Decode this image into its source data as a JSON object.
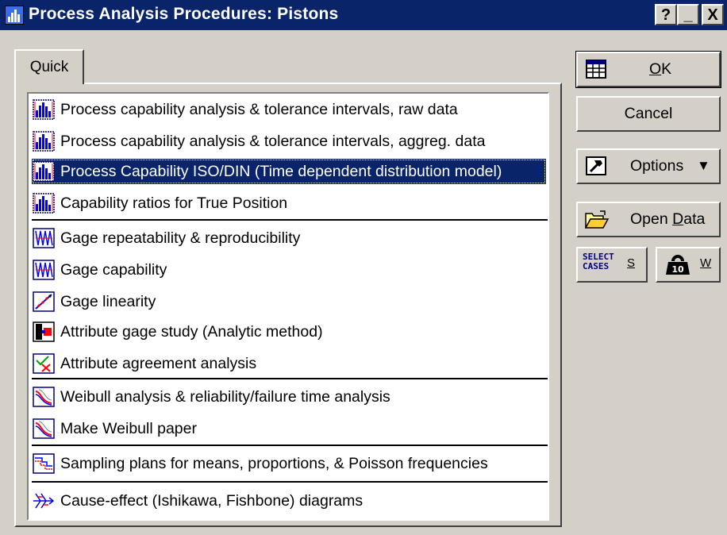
{
  "window": {
    "title": "Process Analysis Procedures: Pistons",
    "controls": {
      "help": "?",
      "minimize": "_",
      "close": "X"
    }
  },
  "tabs": [
    {
      "label": "Quick",
      "selected": true
    }
  ],
  "list": {
    "selected_index": 2,
    "items": [
      {
        "label": "Process capability analysis & tolerance intervals, raw data",
        "icon": "capability-histogram-icon"
      },
      {
        "label": "Process capability analysis & tolerance intervals, aggreg. data",
        "icon": "capability-histogram-icon"
      },
      {
        "label": "Process Capability  ISO/DIN (Time dependent distribution model)",
        "icon": "capability-histogram-icon"
      },
      {
        "label": "Capability ratios for True Position",
        "icon": "capability-histogram-icon"
      },
      {
        "label": "Gage repeatability & reproducibility",
        "icon": "gage-rr-icon"
      },
      {
        "label": "Gage capability",
        "icon": "gage-rr-icon"
      },
      {
        "label": "Gage linearity",
        "icon": "gage-linearity-icon"
      },
      {
        "label": "Attribute gage study (Analytic method)",
        "icon": "attribute-gage-icon"
      },
      {
        "label": "Attribute agreement analysis",
        "icon": "attribute-agreement-icon"
      },
      {
        "label": "Weibull analysis & reliability/failure time analysis",
        "icon": "weibull-icon"
      },
      {
        "label": "Make Weibull paper",
        "icon": "weibull-icon"
      },
      {
        "label": "Sampling plans for means, proportions, & Poisson frequencies",
        "icon": "sampling-plan-icon"
      },
      {
        "label": "Cause-effect (Ishikawa, Fishbone) diagrams",
        "icon": "fishbone-icon"
      }
    ]
  },
  "buttons": {
    "ok": {
      "label_prefix": "",
      "label_mnemonic": "O",
      "label_suffix": "K",
      "icon": "spreadsheet-icon"
    },
    "cancel": {
      "label": "Cancel"
    },
    "options": {
      "label": "Options",
      "icon": "hammer-icon",
      "arrow": "▼"
    },
    "open_data": {
      "label_prefix": "Open ",
      "label_mnemonic": "D",
      "label_suffix": "ata",
      "icon": "folder-open-icon"
    },
    "select_cases": {
      "icon_text_line1": "SELECT",
      "icon_text_line2": "CASES",
      "label": "S"
    },
    "weight": {
      "label": "W",
      "icon": "weight-icon"
    }
  },
  "colors": {
    "titlebar": "#0a246a",
    "selection": "#0a246a",
    "face": "#d4d0c8",
    "icon_blue": "#0000ff",
    "icon_red": "#ff0000"
  }
}
